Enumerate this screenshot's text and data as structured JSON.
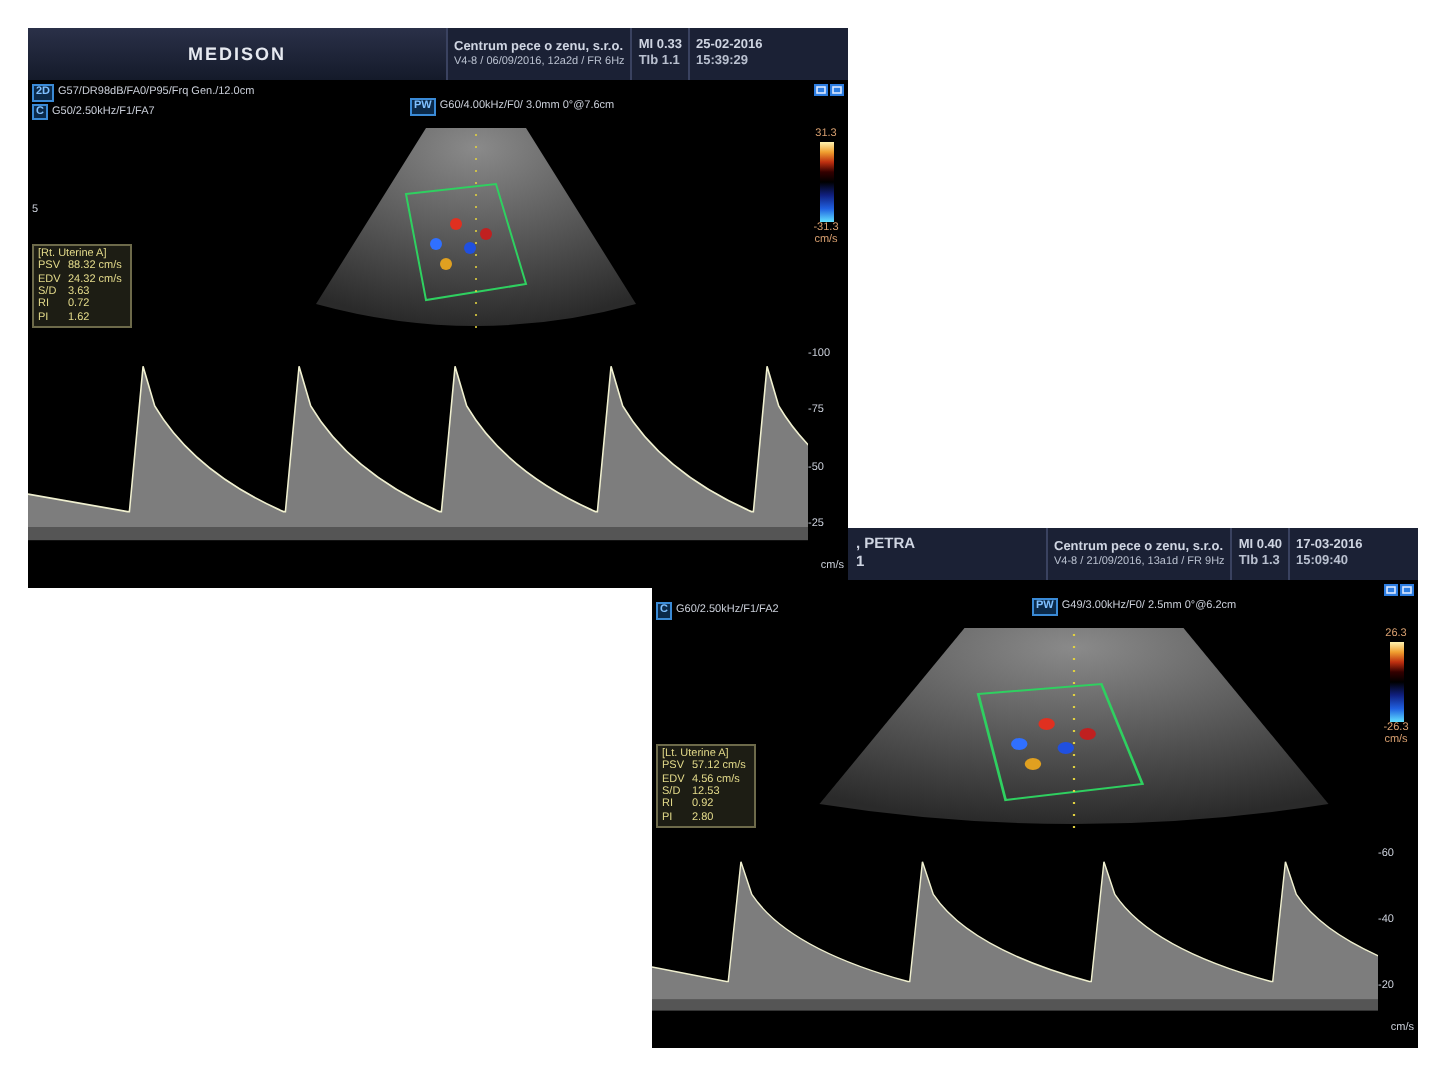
{
  "panels": [
    {
      "header": {
        "logo": "MEDISON",
        "institution": "Centrum pece o zenu, s.r.o.",
        "probe": "V4-8 / 06/09/2016, 12a2d / FR 6Hz",
        "mi": "MI  0.33",
        "tib": "TIb 1.1",
        "date": "25-02-2016",
        "time": "15:39:29"
      },
      "params": [
        {
          "mode": "2D",
          "text": "G57/DR98dB/FA0/P95/Frq Gen./12.0cm"
        },
        {
          "mode": "C",
          "text": "G50/2.50kHz/F1/FA7"
        }
      ],
      "doppler_params": {
        "mode": "PW",
        "text": "G60/4.00kHz/F0/ 3.0mm 0°@7.6cm"
      },
      "depth_marks": [
        "5"
      ],
      "color_scale": {
        "max": "31.3",
        "min": "-31.3",
        "unit": "cm/s"
      },
      "measurement": {
        "title": "[Rt. Uterine A]",
        "rows": [
          {
            "label": "PSV",
            "value": "88.32 cm/s"
          },
          {
            "label": "EDV",
            "value": "24.32 cm/s"
          },
          {
            "label": "S/D",
            "value": "3.63"
          },
          {
            "label": "RI",
            "value": "0.72"
          },
          {
            "label": "PI",
            "value": "1.62"
          }
        ]
      },
      "velocity_scale": {
        "ticks": [
          "-100",
          "-75",
          "-50",
          "-25"
        ],
        "unit": "cm/s"
      }
    },
    {
      "header": {
        "patient": [
          ", PETRA",
          "1"
        ],
        "institution": "Centrum pece o zenu, s.r.o.",
        "probe": "V4-8 / 21/09/2016, 13a1d / FR 9Hz",
        "mi": "MI  0.40",
        "tib": "TIb 1.3",
        "date": "17-03-2016",
        "time": "15:09:40"
      },
      "params": [
        {
          "mode": "C",
          "text": "G60/2.50kHz/F1/FA2"
        }
      ],
      "doppler_params": {
        "mode": "PW",
        "text": "G49/3.00kHz/F0/ 2.5mm 0°@6.2cm"
      },
      "color_scale": {
        "max": "26.3",
        "min": "-26.3",
        "unit": "cm/s"
      },
      "measurement": {
        "title": "[Lt. Uterine A]",
        "rows": [
          {
            "label": "PSV",
            "value": "57.12 cm/s"
          },
          {
            "label": "EDV",
            "value": "4.56 cm/s"
          },
          {
            "label": "S/D",
            "value": "12.53"
          },
          {
            "label": "RI",
            "value": "0.92"
          },
          {
            "label": "PI",
            "value": "2.80"
          }
        ]
      },
      "velocity_scale": {
        "ticks": [
          "-60",
          "-40",
          "-20"
        ],
        "unit": "cm/s"
      }
    }
  ]
}
